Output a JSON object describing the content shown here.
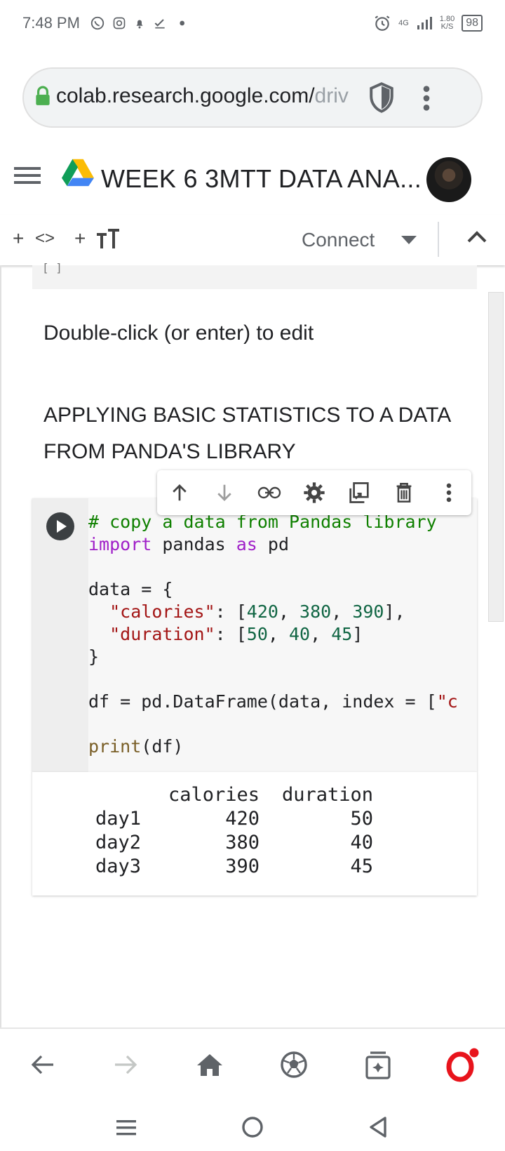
{
  "status_bar": {
    "time": "7:48 PM",
    "network_type": "4G",
    "speed_value": "1.80",
    "speed_unit": "K/S",
    "battery": "98",
    "icons": [
      "whatsapp-icon",
      "instagram-icon",
      "notification-bell-icon",
      "check-icon",
      "dot-icon",
      "alarm-icon",
      "signal-icon"
    ]
  },
  "browser": {
    "url_main": "colab.research.google.com/",
    "url_faded": "driv",
    "icons": [
      "lock-icon",
      "shield-icon",
      "more-vert-icon"
    ]
  },
  "colab": {
    "title": "WEEK 6 3MTT DATA ANA...",
    "icons": [
      "menu-icon",
      "google-drive-icon",
      "avatar"
    ]
  },
  "toolbar": {
    "add_code": "+",
    "code_symbol": "<>",
    "add_text": "+",
    "connect_label": "Connect",
    "icons": [
      "code-brackets-icon",
      "text-format-icon",
      "dropdown-arrow-icon",
      "chevron-up-icon"
    ]
  },
  "text_cell": {
    "hint": "Double-click (or enter) to edit",
    "heading": "APPLYING BASIC STATISTICS TO A DATA FROM PANDA'S LIBRARY"
  },
  "cell_toolbar": {
    "icons": [
      "move-up-icon",
      "move-down-icon",
      "link-icon",
      "settings-icon",
      "mirror-cell-icon",
      "delete-icon",
      "more-vert-icon"
    ]
  },
  "code_cell": {
    "line1_comment": "# copy a data from Pandas library",
    "line2_kw_import": "import",
    "line2_mid": " pandas ",
    "line2_kw_as": "as",
    "line2_end": " pd",
    "line4": "data = {",
    "line5_indent": "  ",
    "line5_key": "\"calories\"",
    "line5_sep": ": [",
    "line5_n1": "420",
    "line5_n2": "380",
    "line5_n3": "390",
    "line5_end": "],",
    "line6_key": "\"duration\"",
    "line6_n1": "50",
    "line6_n2": "40",
    "line6_n3": "45",
    "line6_end": "]",
    "line7": "}",
    "line9": "df = pd.DataFrame(data, index = [",
    "line9_str": "\"c",
    "line11_fn": "print",
    "line11_rest": "(df)"
  },
  "output": {
    "columns": [
      "",
      "calories",
      "duration"
    ],
    "rows": [
      [
        "day1",
        "420",
        "50"
      ],
      [
        "day2",
        "380",
        "40"
      ],
      [
        "day3",
        "390",
        "45"
      ]
    ]
  },
  "bottom_nav": {
    "icons": [
      "back-arrow-icon",
      "forward-arrow-icon",
      "home-icon",
      "soccer-ball-icon",
      "tabs-icon",
      "opera-icon"
    ]
  },
  "system_nav": {
    "icons": [
      "recents-icon",
      "home-circle-icon",
      "back-triangle-icon"
    ]
  }
}
